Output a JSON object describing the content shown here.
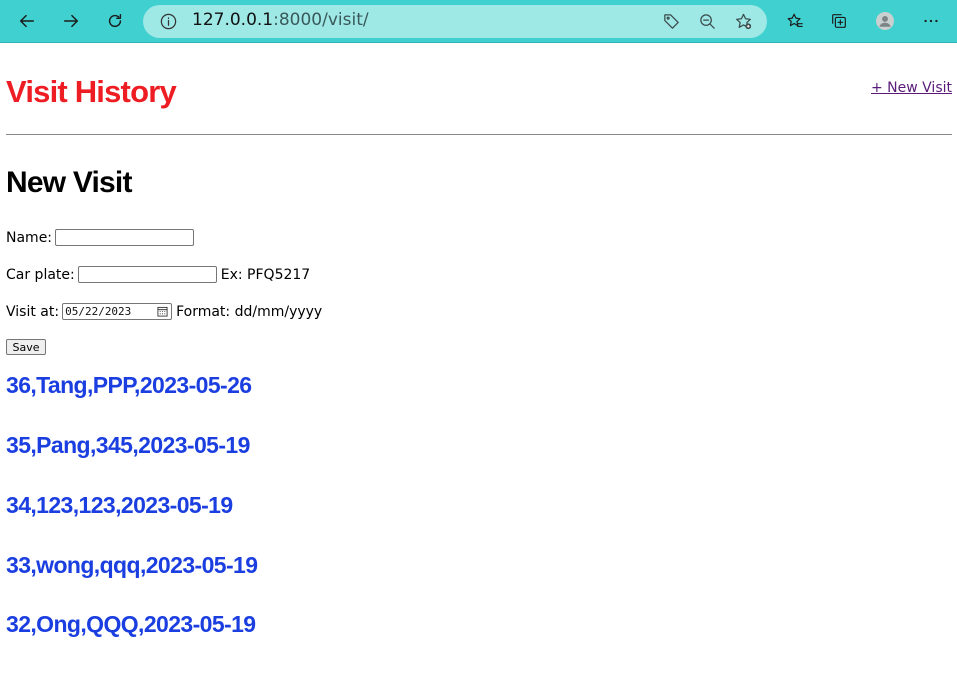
{
  "browser": {
    "url_host": "127.0.0.1",
    "url_rest": ":8000/visit/",
    "icons": [
      "back-icon",
      "forward-icon",
      "refresh-icon",
      "info-icon",
      "tag-icon",
      "zoom-out-icon",
      "add-favorite-icon",
      "favorites-icon",
      "collections-icon",
      "profile-icon",
      "more-icon"
    ]
  },
  "header": {
    "site_title": "Visit History",
    "new_visit_link": "+ New Visit"
  },
  "form": {
    "title": "New Visit",
    "name_label": "Name:",
    "name_value": "",
    "plate_label": "Car plate:",
    "plate_value": "",
    "plate_hint": "Ex: PFQ5217",
    "visit_label": "Visit at:",
    "visit_value": "05/22/2023",
    "visit_hint": "Format: dd/mm/yyyy",
    "save_label": "Save"
  },
  "visits": [
    "36,Tang,PPP,2023-05-26",
    "35,Pang,345,2023-05-19",
    "34,123,123,2023-05-19",
    "33,wong,qqq,2023-05-19",
    "32,Ong,QQQ,2023-05-19"
  ],
  "colors": {
    "toolbar": "#3fd0cf",
    "title_red": "#ee1d23",
    "link_blue": "#1a3ee0",
    "visited_link": "#5a1a7a"
  }
}
